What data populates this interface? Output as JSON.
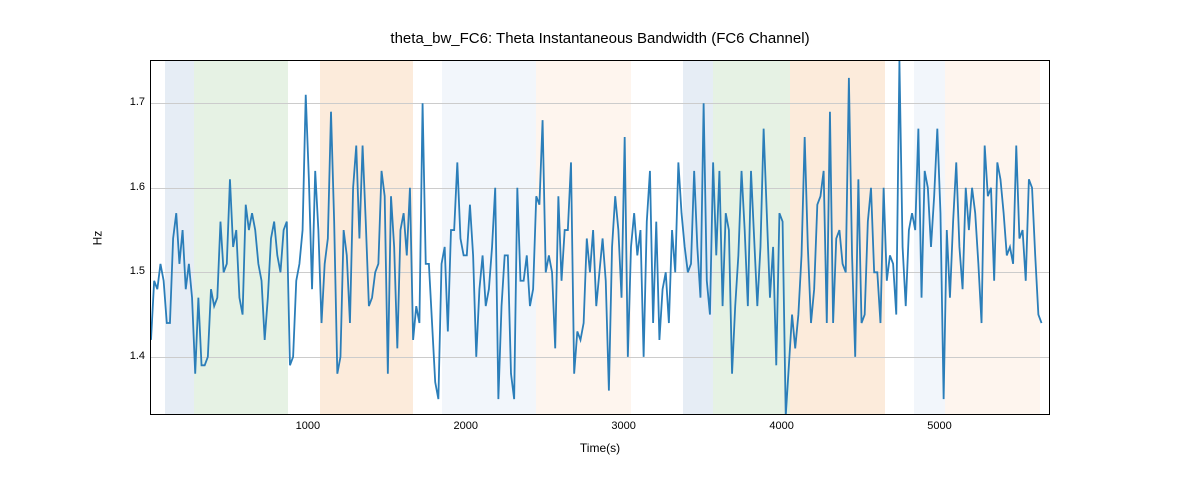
{
  "chart_data": {
    "type": "line",
    "title": "theta_bw_FC6: Theta Instantaneous Bandwidth (FC6 Channel)",
    "xlabel": "Time(s)",
    "ylabel": "Hz",
    "xlim": [
      0,
      5700
    ],
    "ylim": [
      1.33,
      1.75
    ],
    "x_ticks": [
      1000,
      2000,
      3000,
      4000,
      5000
    ],
    "y_ticks": [
      1.4,
      1.5,
      1.6,
      1.7
    ],
    "grid": true,
    "regions": [
      {
        "start": 90,
        "end": 270,
        "color": "#b7cce3"
      },
      {
        "start": 270,
        "end": 870,
        "color": "#b8dbb3"
      },
      {
        "start": 1070,
        "end": 1660,
        "color": "#f6c799"
      },
      {
        "start": 1840,
        "end": 2440,
        "color": "#d9e6f3"
      },
      {
        "start": 2440,
        "end": 3040,
        "color": "#fbe3cd"
      },
      {
        "start": 3370,
        "end": 3560,
        "color": "#b7cce3"
      },
      {
        "start": 3560,
        "end": 4050,
        "color": "#b8dbb3"
      },
      {
        "start": 4050,
        "end": 4650,
        "color": "#f6c799"
      },
      {
        "start": 4830,
        "end": 5030,
        "color": "#d9e6f3"
      },
      {
        "start": 5030,
        "end": 5630,
        "color": "#fbe3cd"
      }
    ],
    "x": [
      0,
      20,
      40,
      60,
      80,
      100,
      120,
      140,
      160,
      180,
      200,
      220,
      240,
      260,
      280,
      300,
      320,
      340,
      360,
      380,
      400,
      420,
      440,
      460,
      480,
      500,
      520,
      540,
      560,
      580,
      600,
      620,
      640,
      660,
      680,
      700,
      720,
      740,
      760,
      780,
      800,
      820,
      840,
      860,
      880,
      900,
      920,
      940,
      960,
      980,
      1000,
      1020,
      1040,
      1060,
      1080,
      1100,
      1120,
      1140,
      1160,
      1180,
      1200,
      1220,
      1240,
      1260,
      1280,
      1300,
      1320,
      1340,
      1360,
      1380,
      1400,
      1420,
      1440,
      1460,
      1480,
      1500,
      1520,
      1540,
      1560,
      1580,
      1600,
      1620,
      1640,
      1660,
      1680,
      1700,
      1720,
      1740,
      1760,
      1780,
      1800,
      1820,
      1840,
      1860,
      1880,
      1900,
      1920,
      1940,
      1960,
      1980,
      2000,
      2020,
      2040,
      2060,
      2080,
      2100,
      2120,
      2140,
      2160,
      2180,
      2200,
      2220,
      2240,
      2260,
      2280,
      2300,
      2320,
      2340,
      2360,
      2380,
      2400,
      2420,
      2440,
      2460,
      2480,
      2500,
      2520,
      2540,
      2560,
      2580,
      2600,
      2620,
      2640,
      2660,
      2680,
      2700,
      2720,
      2740,
      2760,
      2780,
      2800,
      2820,
      2840,
      2860,
      2880,
      2900,
      2920,
      2940,
      2960,
      2980,
      3000,
      3020,
      3040,
      3060,
      3080,
      3100,
      3120,
      3140,
      3160,
      3180,
      3200,
      3220,
      3240,
      3260,
      3280,
      3300,
      3320,
      3340,
      3360,
      3380,
      3400,
      3420,
      3440,
      3460,
      3480,
      3500,
      3520,
      3540,
      3560,
      3580,
      3600,
      3620,
      3640,
      3660,
      3680,
      3700,
      3720,
      3740,
      3760,
      3780,
      3800,
      3820,
      3840,
      3860,
      3880,
      3900,
      3920,
      3940,
      3960,
      3980,
      4000,
      4020,
      4040,
      4060,
      4080,
      4100,
      4120,
      4140,
      4160,
      4180,
      4200,
      4220,
      4240,
      4260,
      4280,
      4300,
      4320,
      4340,
      4360,
      4380,
      4400,
      4420,
      4440,
      4460,
      4480,
      4500,
      4520,
      4540,
      4560,
      4580,
      4600,
      4620,
      4640,
      4660,
      4680,
      4700,
      4720,
      4740,
      4760,
      4780,
      4800,
      4820,
      4840,
      4860,
      4880,
      4900,
      4920,
      4940,
      4960,
      4980,
      5000,
      5020,
      5040,
      5060,
      5080,
      5100,
      5120,
      5140,
      5160,
      5180,
      5200,
      5220,
      5240,
      5260,
      5280,
      5300,
      5320,
      5340,
      5360,
      5380,
      5400,
      5420,
      5440,
      5460,
      5480,
      5500,
      5520,
      5540,
      5560,
      5580,
      5600,
      5620,
      5640
    ],
    "values": [
      1.42,
      1.49,
      1.48,
      1.51,
      1.49,
      1.44,
      1.44,
      1.54,
      1.57,
      1.51,
      1.55,
      1.48,
      1.51,
      1.47,
      1.38,
      1.47,
      1.39,
      1.39,
      1.4,
      1.48,
      1.46,
      1.47,
      1.56,
      1.5,
      1.51,
      1.61,
      1.53,
      1.55,
      1.47,
      1.45,
      1.58,
      1.55,
      1.57,
      1.55,
      1.51,
      1.49,
      1.42,
      1.47,
      1.54,
      1.56,
      1.52,
      1.5,
      1.55,
      1.56,
      1.39,
      1.4,
      1.49,
      1.51,
      1.55,
      1.71,
      1.61,
      1.48,
      1.62,
      1.55,
      1.44,
      1.51,
      1.54,
      1.69,
      1.56,
      1.38,
      1.4,
      1.55,
      1.52,
      1.44,
      1.6,
      1.65,
      1.54,
      1.65,
      1.56,
      1.46,
      1.47,
      1.5,
      1.51,
      1.62,
      1.59,
      1.38,
      1.59,
      1.53,
      1.41,
      1.55,
      1.57,
      1.52,
      1.6,
      1.42,
      1.46,
      1.44,
      1.7,
      1.51,
      1.51,
      1.44,
      1.37,
      1.35,
      1.51,
      1.53,
      1.43,
      1.55,
      1.55,
      1.63,
      1.54,
      1.52,
      1.52,
      1.58,
      1.52,
      1.4,
      1.48,
      1.52,
      1.46,
      1.48,
      1.53,
      1.6,
      1.35,
      1.46,
      1.52,
      1.52,
      1.38,
      1.35,
      1.6,
      1.49,
      1.49,
      1.52,
      1.46,
      1.48,
      1.59,
      1.58,
      1.68,
      1.5,
      1.52,
      1.5,
      1.41,
      1.59,
      1.49,
      1.55,
      1.55,
      1.63,
      1.38,
      1.43,
      1.42,
      1.44,
      1.54,
      1.5,
      1.55,
      1.46,
      1.5,
      1.54,
      1.49,
      1.36,
      1.53,
      1.59,
      1.55,
      1.47,
      1.66,
      1.4,
      1.53,
      1.57,
      1.52,
      1.55,
      1.4,
      1.56,
      1.62,
      1.44,
      1.56,
      1.42,
      1.48,
      1.5,
      1.44,
      1.55,
      1.5,
      1.63,
      1.57,
      1.53,
      1.5,
      1.51,
      1.62,
      1.53,
      1.47,
      1.7,
      1.49,
      1.45,
      1.63,
      1.52,
      1.62,
      1.46,
      1.57,
      1.55,
      1.38,
      1.46,
      1.52,
      1.62,
      1.55,
      1.46,
      1.62,
      1.54,
      1.46,
      1.53,
      1.67,
      1.57,
      1.47,
      1.53,
      1.39,
      1.57,
      1.56,
      1.33,
      1.39,
      1.45,
      1.41,
      1.45,
      1.52,
      1.66,
      1.53,
      1.44,
      1.48,
      1.58,
      1.59,
      1.62,
      1.44,
      1.69,
      1.44,
      1.54,
      1.55,
      1.51,
      1.5,
      1.73,
      1.52,
      1.4,
      1.61,
      1.44,
      1.45,
      1.56,
      1.6,
      1.5,
      1.5,
      1.44,
      1.6,
      1.49,
      1.52,
      1.51,
      1.45,
      1.75,
      1.53,
      1.46,
      1.55,
      1.57,
      1.55,
      1.67,
      1.47,
      1.62,
      1.6,
      1.53,
      1.59,
      1.67,
      1.57,
      1.35,
      1.55,
      1.47,
      1.56,
      1.63,
      1.53,
      1.48,
      1.6,
      1.55,
      1.6,
      1.57,
      1.51,
      1.44,
      1.65,
      1.59,
      1.6,
      1.49,
      1.63,
      1.61,
      1.57,
      1.52,
      1.53,
      1.51,
      1.65,
      1.54,
      1.55,
      1.49,
      1.61,
      1.6,
      1.52,
      1.45,
      1.44
    ]
  }
}
